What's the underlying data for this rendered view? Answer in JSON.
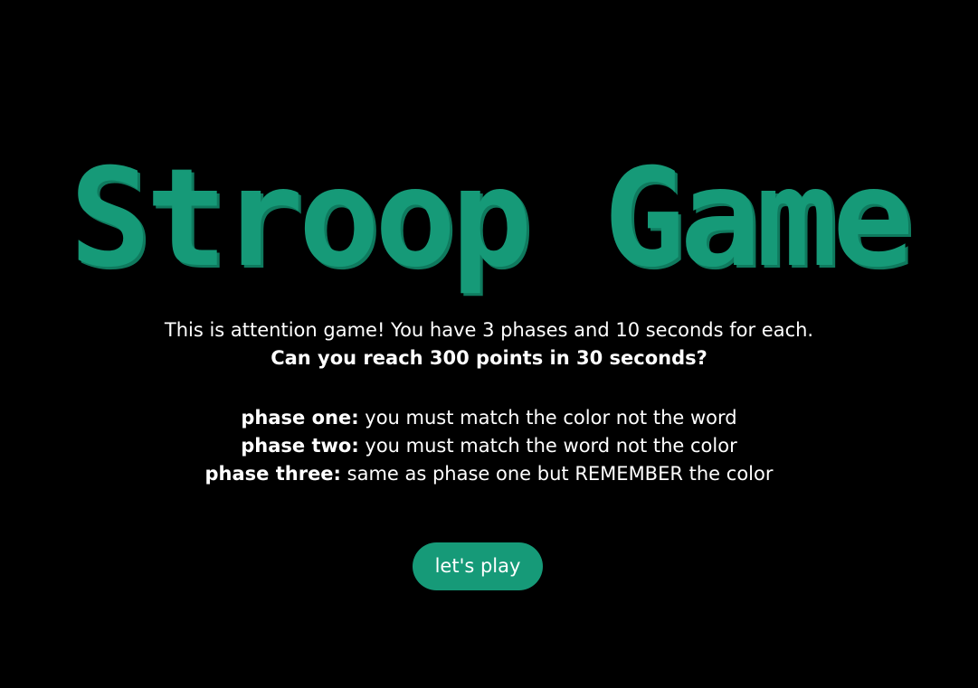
{
  "game": {
    "title": "Stroop Game",
    "intro_text": "This is attention game! You have 3 phases and 10 seconds for each.",
    "challenge_text": "Can you reach 300 points in 30 seconds?",
    "phases": [
      {
        "label": "phase one:",
        "description": " you must match the color not the word"
      },
      {
        "label": "phase two:",
        "description": " you must match the word not the color"
      },
      {
        "label": "phase three:",
        "description": " same as phase one but REMEMBER the color"
      }
    ],
    "play_button_label": "let's play"
  },
  "colors": {
    "background": "#000000",
    "accent": "#169a78",
    "text": "#ffffff"
  }
}
